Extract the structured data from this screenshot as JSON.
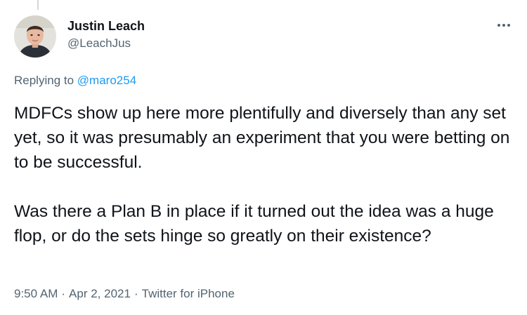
{
  "tweet": {
    "author": {
      "name": "Justin Leach",
      "handle": "@LeachJus",
      "avatar_icon": "user-avatar-photo"
    },
    "more_icon": "more-horizontal-icon",
    "replying": {
      "prefix": "Replying to",
      "mention": "@maro254"
    },
    "paragraphs": [
      "MDFCs show up here more plentifully and diversely than any set yet, so it was presumably an experiment that you were betting on to be successful.",
      "Was there a Plan B in place if it turned out the idea was a huge flop, or do the sets hinge so greatly on their existence?"
    ],
    "meta": {
      "time": "9:50 AM",
      "separator": "·",
      "date": "Apr 2, 2021",
      "source": "Twitter for iPhone"
    },
    "colors": {
      "text": "#0f1419",
      "secondary": "#536471",
      "link": "#1d9bf0",
      "thread_line": "#cfd9de"
    }
  }
}
